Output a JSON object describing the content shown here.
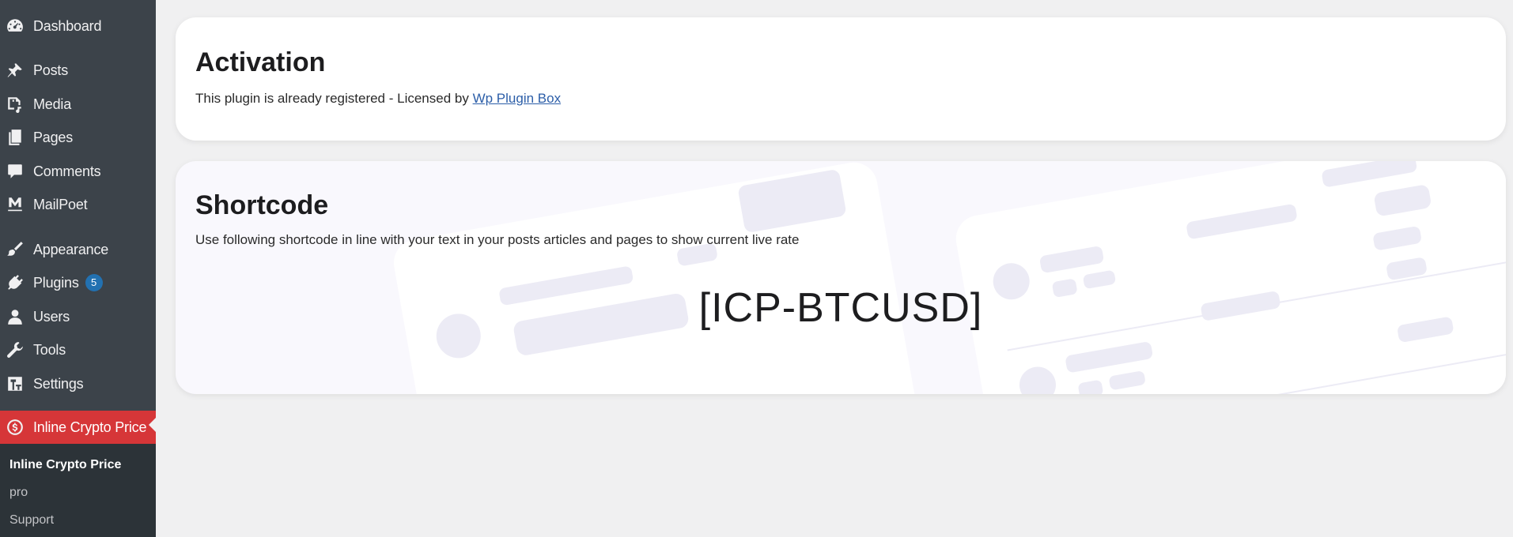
{
  "sidebar": {
    "items": [
      {
        "label": "Dashboard",
        "icon": "dashboard-icon"
      },
      {
        "label": "Posts",
        "icon": "pin-icon"
      },
      {
        "label": "Media",
        "icon": "media-icon"
      },
      {
        "label": "Pages",
        "icon": "pages-icon"
      },
      {
        "label": "Comments",
        "icon": "comment-icon"
      },
      {
        "label": "MailPoet",
        "icon": "mailpoet-icon"
      },
      {
        "label": "Appearance",
        "icon": "brush-icon"
      },
      {
        "label": "Plugins",
        "icon": "plugin-icon",
        "badge": "5"
      },
      {
        "label": "Users",
        "icon": "user-icon"
      },
      {
        "label": "Tools",
        "icon": "wrench-icon"
      },
      {
        "label": "Settings",
        "icon": "settings-icon"
      },
      {
        "label": "Inline Crypto Price",
        "icon": "dollar-icon"
      }
    ],
    "submenu": [
      "Inline Crypto Price",
      "pro",
      "Support"
    ],
    "active_color": "#d63638",
    "badge_color": "#2271b1"
  },
  "activation": {
    "title": "Activation",
    "text": "This plugin is already registered - Licensed by ",
    "link": "Wp Plugin Box"
  },
  "shortcode": {
    "title": "Shortcode",
    "text": "Use following shortcode in line with your text in your posts articles and pages to show current live rate",
    "value": "[ICP-BTCUSD]"
  }
}
